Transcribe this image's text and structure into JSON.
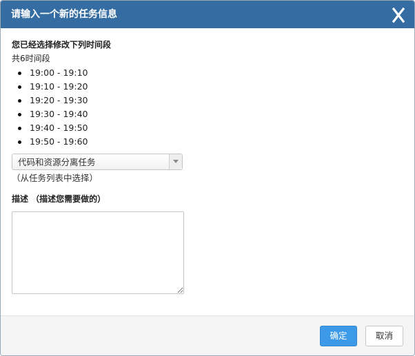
{
  "dialog": {
    "title": "请输入一个新的任务信息",
    "close_icon": "close-x-icon"
  },
  "selection": {
    "heading": "您已经选择修改下列时间段",
    "count_text": "共6时间段",
    "slots": [
      "19:00 - 19:10",
      "19:10 - 19:20",
      "19:20 - 19:30",
      "19:30 - 19:40",
      "19:40 - 19:50",
      "19:50 - 19:60"
    ]
  },
  "task_select": {
    "value": "代码和资源分离任务",
    "hint": "（从任务列表中选择）",
    "arrow_icon": "chevron-down-icon"
  },
  "description": {
    "label": "描述 （描述您需要做的）",
    "value": ""
  },
  "footer": {
    "ok_label": "确定",
    "cancel_label": "取消"
  },
  "colors": {
    "titlebar": "#356da3",
    "primary_button": "#3d9ae8"
  }
}
